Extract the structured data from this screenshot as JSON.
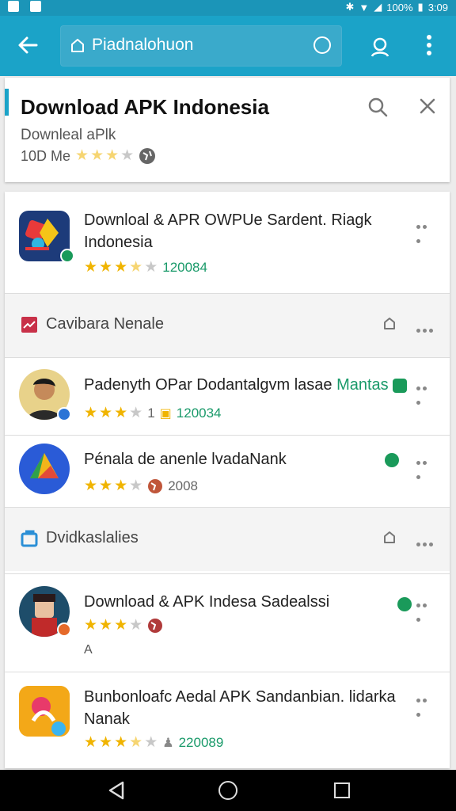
{
  "status_bar": {
    "battery": "100%",
    "time": "3:09"
  },
  "app_bar": {
    "search_query": "Piadnalohuon",
    "back_icon": "arrow-left-icon",
    "mic_icon": "mic-icon",
    "account_icon": "person-icon",
    "menu_icon": "more-vert-icon"
  },
  "top_result": {
    "title": "Download APK Indonesia",
    "subtitle": "Downleal aPlk",
    "size": "10D Me",
    "rating": 4,
    "accent_color": "#1ba3c8"
  },
  "items": [
    {
      "name": "Downloal & APR OWPUe Sardent. Riagk Indonesia",
      "rating": 3.5,
      "count": "120084"
    },
    {
      "name": "Padenyth OPar Dodantalgvm lasae",
      "tag": "Mantas",
      "rating": 3,
      "rating_extra": "1",
      "count": "120034"
    },
    {
      "name": "Pénala de anenle lvadaNank",
      "rating": 3,
      "count": "2008"
    },
    {
      "name": "Download & APK Indesa Sadealssi",
      "rating": 3,
      "extra": "A"
    },
    {
      "name": "Bunbonloafc Aedal APK Sandanbian. lidarka Nanak",
      "rating": 3.5,
      "count": "220089"
    }
  ],
  "sections": [
    {
      "title": "Cavibara Nenale"
    },
    {
      "title": "Dvidkaslalies"
    }
  ],
  "colors": {
    "primary": "#1ba3c8",
    "status_bar": "#1b95b8",
    "star": "#f0b400",
    "count_green": "#1a9a6a"
  }
}
